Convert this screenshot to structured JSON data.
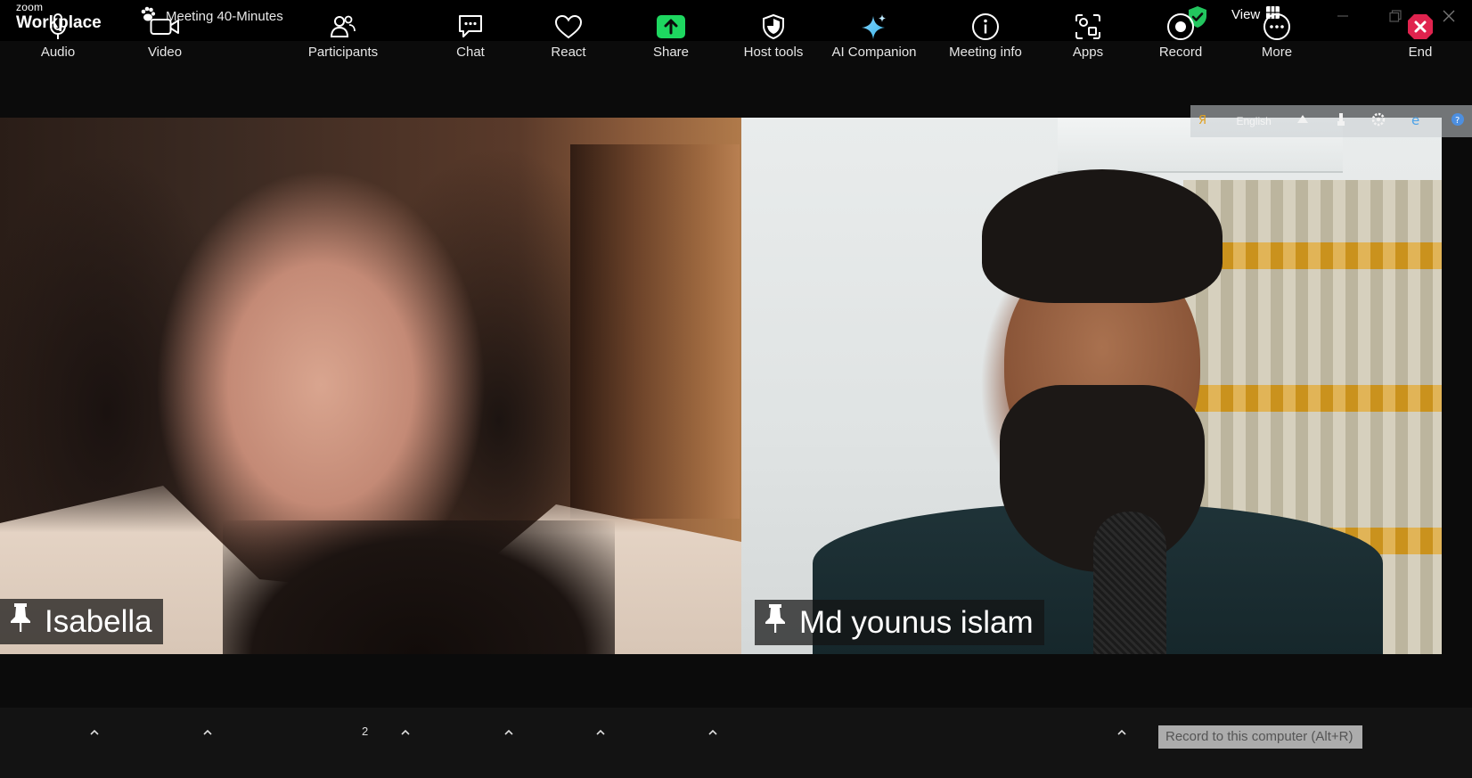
{
  "titlebar": {
    "brand_small": "zoom",
    "brand_big": "Workplace",
    "meeting_title": "Meeting 40-Minutes",
    "view_label": "View",
    "shield_color": "#22c55e"
  },
  "translate_bar": {
    "language": "English"
  },
  "participants": [
    {
      "name": "Isabella"
    },
    {
      "name": "Md younus islam"
    }
  ],
  "toolbar": {
    "audio": "Audio",
    "video": "Video",
    "participants": "Participants",
    "participants_count": "2",
    "chat": "Chat",
    "react": "React",
    "share": "Share",
    "host_tools": "Host tools",
    "ai_companion": "AI Companion",
    "meeting_info": "Meeting info",
    "apps": "Apps",
    "record": "Record",
    "more": "More",
    "end": "End",
    "record_tooltip": "Record to this computer (Alt+R)",
    "share_color": "#1ed760",
    "end_color": "#e0234e"
  }
}
